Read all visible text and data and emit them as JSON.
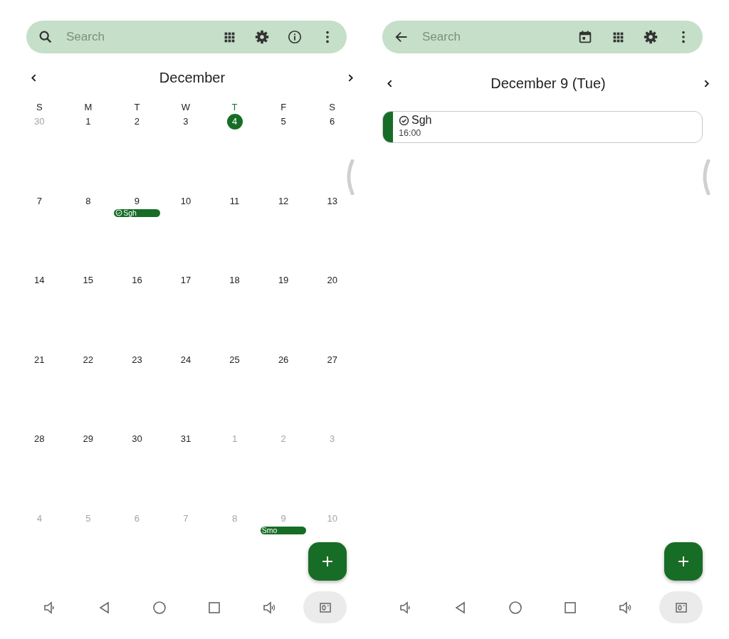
{
  "screens": [
    {
      "kind": "month",
      "search": {
        "placeholder": "Search"
      },
      "title": "December",
      "weekdays": [
        {
          "label": "S",
          "today": false
        },
        {
          "label": "M",
          "today": false
        },
        {
          "label": "T",
          "today": false
        },
        {
          "label": "W",
          "today": false
        },
        {
          "label": "T",
          "today": true
        },
        {
          "label": "F",
          "today": false
        },
        {
          "label": "S",
          "today": false
        }
      ],
      "weeks": [
        [
          {
            "label": "30",
            "other_month": true,
            "today": false
          },
          {
            "label": "1",
            "other_month": false,
            "today": false
          },
          {
            "label": "2",
            "other_month": false,
            "today": false
          },
          {
            "label": "3",
            "other_month": false,
            "today": false
          },
          {
            "label": "4",
            "other_month": false,
            "today": true
          },
          {
            "label": "5",
            "other_month": false,
            "today": false
          },
          {
            "label": "6",
            "other_month": false,
            "today": false
          }
        ],
        [
          {
            "label": "7",
            "other_month": false,
            "today": false
          },
          {
            "label": "8",
            "other_month": false,
            "today": false
          },
          {
            "label": "9",
            "other_month": false,
            "today": false,
            "events": [
              {
                "title": "Sgh",
                "done": true
              }
            ]
          },
          {
            "label": "10",
            "other_month": false,
            "today": false
          },
          {
            "label": "11",
            "other_month": false,
            "today": false
          },
          {
            "label": "12",
            "other_month": false,
            "today": false
          },
          {
            "label": "13",
            "other_month": false,
            "today": false
          }
        ],
        [
          {
            "label": "14",
            "other_month": false,
            "today": false
          },
          {
            "label": "15",
            "other_month": false,
            "today": false
          },
          {
            "label": "16",
            "other_month": false,
            "today": false
          },
          {
            "label": "17",
            "other_month": false,
            "today": false
          },
          {
            "label": "18",
            "other_month": false,
            "today": false
          },
          {
            "label": "19",
            "other_month": false,
            "today": false
          },
          {
            "label": "20",
            "other_month": false,
            "today": false
          }
        ],
        [
          {
            "label": "21",
            "other_month": false,
            "today": false
          },
          {
            "label": "22",
            "other_month": false,
            "today": false
          },
          {
            "label": "23",
            "other_month": false,
            "today": false
          },
          {
            "label": "24",
            "other_month": false,
            "today": false
          },
          {
            "label": "25",
            "other_month": false,
            "today": false
          },
          {
            "label": "26",
            "other_month": false,
            "today": false
          },
          {
            "label": "27",
            "other_month": false,
            "today": false
          }
        ],
        [
          {
            "label": "28",
            "other_month": false,
            "today": false
          },
          {
            "label": "29",
            "other_month": false,
            "today": false
          },
          {
            "label": "30",
            "other_month": false,
            "today": false
          },
          {
            "label": "31",
            "other_month": false,
            "today": false
          },
          {
            "label": "1",
            "other_month": true,
            "today": false
          },
          {
            "label": "2",
            "other_month": true,
            "today": false
          },
          {
            "label": "3",
            "other_month": true,
            "today": false
          }
        ],
        [
          {
            "label": "4",
            "other_month": true,
            "today": false
          },
          {
            "label": "5",
            "other_month": true,
            "today": false
          },
          {
            "label": "6",
            "other_month": true,
            "today": false
          },
          {
            "label": "7",
            "other_month": true,
            "today": false
          },
          {
            "label": "8",
            "other_month": true,
            "today": false
          },
          {
            "label": "9",
            "other_month": true,
            "today": false,
            "events": [
              {
                "title": "Smo",
                "done": false
              }
            ]
          },
          {
            "label": "10",
            "other_month": true,
            "today": false
          }
        ]
      ]
    },
    {
      "kind": "day",
      "search": {
        "placeholder": "Search"
      },
      "title": "December 9 (Tue)",
      "events": [
        {
          "title": "Sgh",
          "time": "16:00",
          "done": true
        }
      ]
    }
  ]
}
